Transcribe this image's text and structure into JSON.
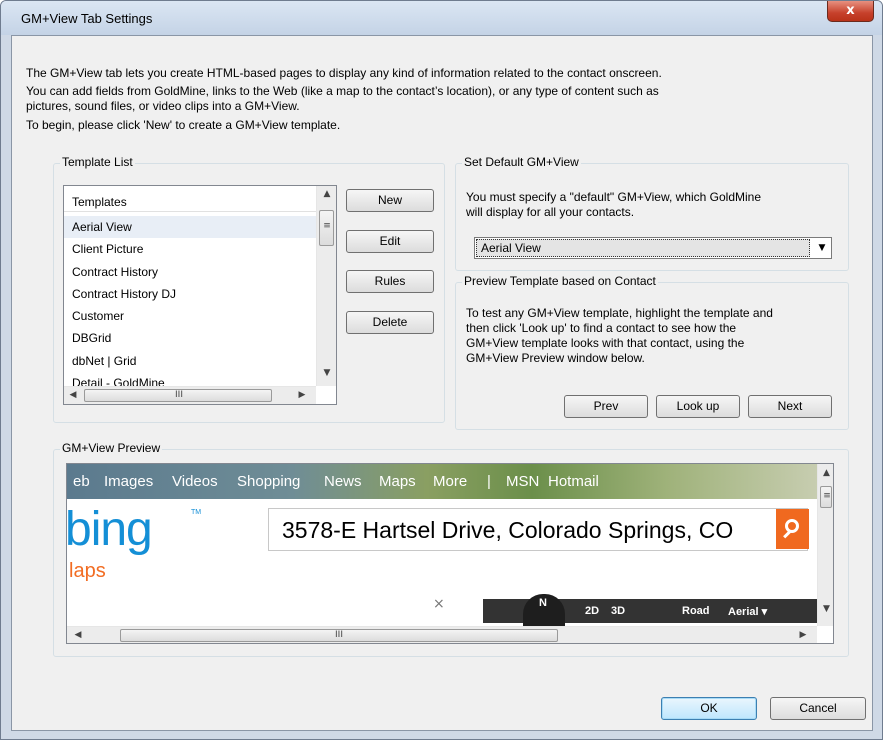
{
  "window": {
    "title": "GM+View Tab Settings",
    "close_label": "x"
  },
  "intro": {
    "line1": "The GM+View tab lets you  create HTML-based pages to display any kind of information related to the contact onscreen.",
    "line2": "You can add fields from GoldMine, links to the Web (like a map to the contact’s location), or any type of content such as",
    "line3": "pictures, sound files, or video clips into a GM+View.",
    "line4": "To begin, please click 'New' to create a GM+View template."
  },
  "template_list": {
    "legend": "Template List",
    "header": "Templates",
    "items": [
      "Aerial View",
      "Client Picture",
      "Contract History",
      "Contract History DJ",
      "Customer",
      "DBGrid",
      "dbNet | Grid",
      "Detail - GoldMine"
    ],
    "selected": "Aerial View",
    "buttons": {
      "new": "New",
      "edit": "Edit",
      "rules": "Rules",
      "delete": "Delete"
    }
  },
  "default_view": {
    "legend": "Set Default GM+View",
    "text1": "You must specify a \"default\" GM+View, which GoldMine",
    "text2": "will display for all your contacts.",
    "selected": "Aerial View"
  },
  "preview_template": {
    "legend": "Preview Template based on Contact",
    "text1": "To test any GM+View template, highlight the template and",
    "text2": "then click 'Look up' to find a contact to see how the",
    "text3": "GM+View template looks with that contact, using the",
    "text4": "GM+View Preview window below.",
    "buttons": {
      "prev": "Prev",
      "lookup": "Look up",
      "next": "Next"
    }
  },
  "gm_preview": {
    "legend": "GM+View Preview",
    "nav": [
      "eb",
      "Images",
      "Videos",
      "Shopping",
      "News",
      "Maps",
      "More",
      "|",
      "MSN",
      "Hotmail"
    ],
    "logo": "bing",
    "tm": "TM",
    "section": "laps",
    "query": "3578-E Hartsel Drive, Colorado Springs, CO",
    "map_controls": {
      "north": "N",
      "d2": "2D",
      "d3": "3D",
      "road": "Road",
      "aerial": "Aerial ▾"
    },
    "close": "×"
  },
  "footer": {
    "ok": "OK",
    "cancel": "Cancel"
  },
  "scroll": {
    "up": "▲",
    "down": "▼",
    "left": "◀",
    "right": "▶",
    "grip": "III",
    "vgrip": "≡"
  }
}
